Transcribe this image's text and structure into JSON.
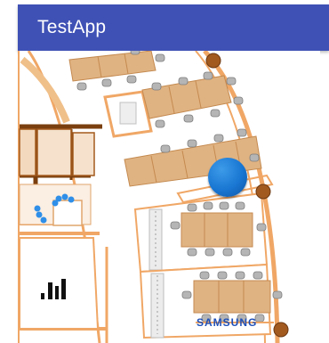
{
  "app": {
    "title": "TestApp"
  },
  "map": {
    "brand_label": "SAMSUNG",
    "colors": {
      "wall": "#f0a766",
      "wall_dark": "#a0520f",
      "desk": "#e0b382",
      "chair": "#b0b0b0",
      "pillar": "#a25a1f",
      "location_dot": "#1976d2",
      "beacon_dots": "#2f8fe8"
    },
    "icons": [
      "signal-bars-icon",
      "location-dot-icon",
      "beacon-cluster-icon"
    ]
  }
}
